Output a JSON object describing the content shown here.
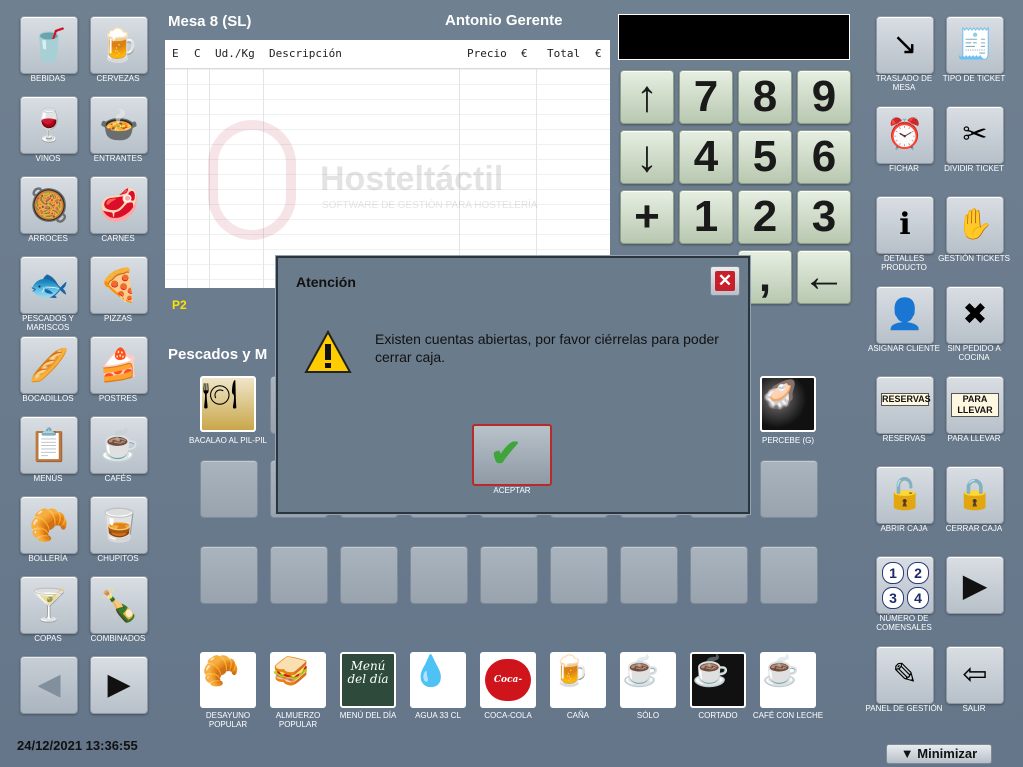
{
  "header": {
    "mesa": "Mesa 8 (SL)",
    "user": "Antonio Gerente"
  },
  "ticket": {
    "columns": [
      "E",
      "C",
      "Ud./Kg",
      "Descripción",
      "Precio",
      "€",
      "Total",
      "€"
    ],
    "watermark": {
      "brand": "Hosteltáctil",
      "tagline": "SOFTWARE DE GESTIÓN PARA HOSTELERÍA"
    },
    "page_label": "P2"
  },
  "category_title": "Pescados y M",
  "left_categories": [
    {
      "label": "BEBIDAS",
      "icon": "drink-glass-icon"
    },
    {
      "label": "CERVEZAS",
      "icon": "beer-mug-icon"
    },
    {
      "label": "VINOS",
      "icon": "wine-glass-icon"
    },
    {
      "label": "ENTRANTES",
      "icon": "soup-plate-icon"
    },
    {
      "label": "ARROCES",
      "icon": "paella-icon"
    },
    {
      "label": "CARNES",
      "icon": "steak-icon"
    },
    {
      "label": "PESCADOS Y MARISCOS",
      "icon": "fish-icon"
    },
    {
      "label": "PIZZAS",
      "icon": "pizza-icon"
    },
    {
      "label": "BOCADILLOS",
      "icon": "sandwich-icon"
    },
    {
      "label": "POSTRES",
      "icon": "cake-icon"
    },
    {
      "label": "MENÚS",
      "icon": "menu-board-icon"
    },
    {
      "label": "CAFÉS",
      "icon": "coffee-cup-icon"
    },
    {
      "label": "BOLLERÍA",
      "icon": "croissant-icon"
    },
    {
      "label": "CHUPITOS",
      "icon": "shot-glass-icon"
    },
    {
      "label": "COPAS",
      "icon": "brandy-glass-icon"
    },
    {
      "label": "COMBINADOS",
      "icon": "cola-bottle-icon"
    }
  ],
  "keypad": [
    "↑",
    "7",
    "8",
    "9",
    "↓",
    "4",
    "5",
    "6",
    "+",
    "1",
    "2",
    "3",
    "",
    "",
    ",",
    "←"
  ],
  "right_actions": [
    {
      "label": "TRASLADO DE MESA",
      "icon": "table-move-icon"
    },
    {
      "label": "TIPO DE TICKET",
      "icon": "ticket-type-icon"
    },
    {
      "label": "FICHAR",
      "icon": "clock-in-icon"
    },
    {
      "label": "DIVIDIR TICKET",
      "icon": "split-ticket-icon"
    },
    {
      "label": "DETALLES PRODUCTO",
      "icon": "product-details-icon"
    },
    {
      "label": "GESTIÓN TICKETS",
      "icon": "manage-tickets-icon"
    },
    {
      "label": "ASIGNAR CLIENTE",
      "icon": "assign-client-icon"
    },
    {
      "label": "SIN PEDIDO A COCINA",
      "icon": "no-kitchen-order-icon"
    },
    {
      "label": "RESERVAS",
      "icon": "reservations-icon",
      "sign": "RESERVAS"
    },
    {
      "label": "PARA LLEVAR",
      "icon": "takeaway-bag-icon",
      "sign": "PARA LLEVAR"
    },
    {
      "label": "ABRIR CAJA",
      "icon": "open-safe-icon"
    },
    {
      "label": "CERRAR CAJA",
      "icon": "close-safe-icon"
    },
    {
      "label": "NÚMERO DE COMENSALES",
      "icon": "diners-number-icon",
      "digits": [
        "1",
        "2",
        "3",
        "4"
      ]
    },
    {
      "label": "",
      "icon": "play-arrow-icon"
    },
    {
      "label": "PANEL DE GESTIÓN",
      "icon": "management-panel-icon"
    },
    {
      "label": "SALIR",
      "icon": "exit-icon"
    }
  ],
  "products_row1": [
    {
      "label": "BACALAO AL PIL-PIL",
      "icon": "cod-dish-icon",
      "col": 0
    },
    {
      "label": "PERCEBE (G)",
      "icon": "barnacles-icon",
      "col": 8
    }
  ],
  "quick_products": [
    {
      "label": "DESAYUNO POPULAR",
      "icon": "breakfast-icon"
    },
    {
      "label": "ALMUERZO POPULAR",
      "icon": "lunch-icon"
    },
    {
      "label": "MENÚ DEL DÍA",
      "icon": "menu-chalkboard-icon",
      "sign": "Menú del día"
    },
    {
      "label": "AGUA 33 CL",
      "icon": "water-bottle-icon"
    },
    {
      "label": "COCA-COLA",
      "icon": "coca-cola-icon",
      "sign": "Coca-Cola"
    },
    {
      "label": "CAÑA",
      "icon": "beer-glass-icon"
    },
    {
      "label": "SÓLO",
      "icon": "espresso-icon"
    },
    {
      "label": "CORTADO",
      "icon": "cortado-icon"
    },
    {
      "label": "CAFÉ CON LECHE",
      "icon": "coffee-milk-icon"
    }
  ],
  "modal": {
    "title": "Atención",
    "message": "Existen cuentas abiertas, por favor ciérrelas para poder cerrar caja.",
    "ok_label": "ACEPTAR"
  },
  "footer": {
    "datetime": "24/12/2021 13:36:55",
    "minimize_label": "▼ Minimizar"
  },
  "colors": {
    "background": "#6b7b8c",
    "accent_yellow": "#ffe100",
    "alert_red": "#c8202a",
    "ok_green": "#3fa43a"
  }
}
